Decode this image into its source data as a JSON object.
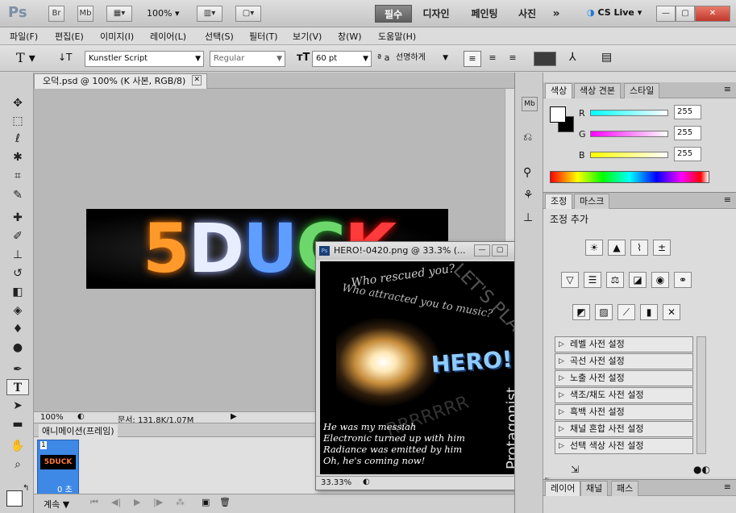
{
  "titlebar": {
    "logo": "Ps",
    "br": "Br",
    "mb": "Mb",
    "zoom": "100%",
    "workspaces": [
      "필수",
      "디자인",
      "페인팅",
      "사진"
    ],
    "more": "»",
    "cslive": "CS Live"
  },
  "menu": [
    "파일(F)",
    "편집(E)",
    "이미지(I)",
    "레이어(L)",
    "선택(S)",
    "필터(T)",
    "보기(V)",
    "창(W)",
    "도움말(H)"
  ],
  "options": {
    "font_family": "Kunstler Script",
    "font_style": "Regular",
    "font_size": "60 pt",
    "aa_label": "ª a",
    "antialias": "선명하게"
  },
  "document": {
    "tab_title": "오덕.psd @ 100% (K 사본, RGB/8)",
    "zoom": "100%",
    "doc_info": "문서: 131.8K/1.07M",
    "canvas_text": "5DUCK"
  },
  "hero_window": {
    "title": "HERO!-0420.png @ 33.3% (...",
    "zoom": "33.33%",
    "line1": "Who rescued you?",
    "line2": "Who attracted you to music?",
    "diag": "LET'S PLAY!",
    "hero": "HERO!",
    "rrr": "RRRRRRR",
    "side": "Protagonist",
    "poem": [
      "He was my messiah",
      "Electronic turned up with him",
      "Radiance was emitted by him",
      "Oh, he's coming now!"
    ]
  },
  "animation": {
    "tab": "애니메이션(프레임)",
    "frame_number": "1",
    "frame_time": "0 초",
    "loop": "계속"
  },
  "color_panel": {
    "tabs": [
      "색상",
      "색상 견본",
      "스타일"
    ],
    "r_label": "R",
    "g_label": "G",
    "b_label": "B",
    "r": "255",
    "g": "255",
    "b": "255"
  },
  "adjust_panel": {
    "tabs": [
      "조정",
      "마스크"
    ],
    "heading": "조정 추가",
    "presets": [
      "레벨 사전 설정",
      "곡선 사전 설정",
      "노출 사전 설정",
      "색조/채도 사전 설정",
      "흑백 사전 설정",
      "채널 혼합 사전 설정",
      "선택 색상 사전 설정"
    ]
  },
  "layer_panel": {
    "tabs": [
      "레이어",
      "채널",
      "패스"
    ]
  }
}
